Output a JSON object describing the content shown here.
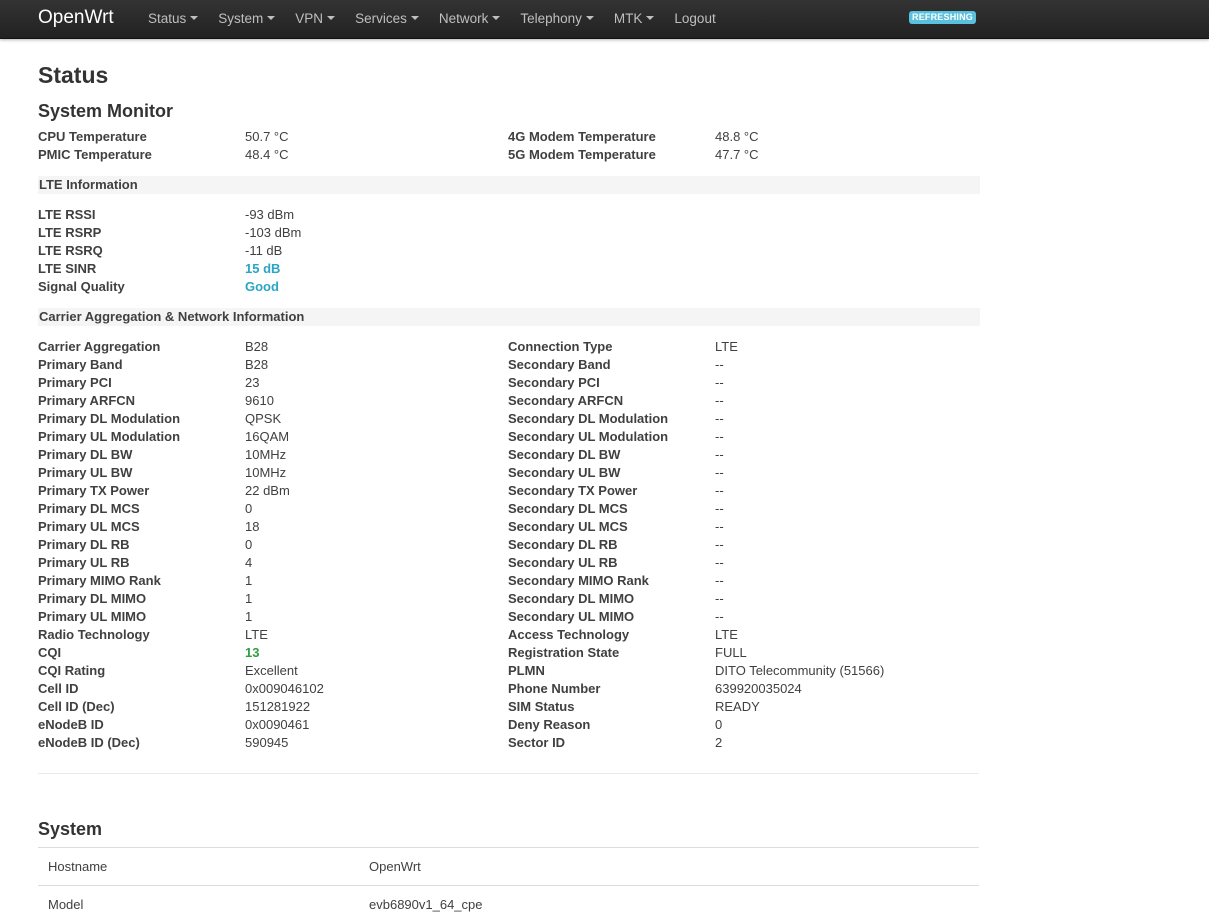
{
  "nav": {
    "brand": "OpenWrt",
    "items": [
      {
        "label": "Status",
        "dropdown": true
      },
      {
        "label": "System",
        "dropdown": true
      },
      {
        "label": "VPN",
        "dropdown": true
      },
      {
        "label": "Services",
        "dropdown": true
      },
      {
        "label": "Network",
        "dropdown": true
      },
      {
        "label": "Telephony",
        "dropdown": true
      },
      {
        "label": "MTK",
        "dropdown": true
      },
      {
        "label": "Logout",
        "dropdown": false
      }
    ],
    "badge": "REFRESHING"
  },
  "page_title": "Status",
  "system_monitor": {
    "title": "System Monitor",
    "rows": [
      {
        "l1": "CPU Temperature",
        "v1": "50.7 °C",
        "l2": "4G Modem Temperature",
        "v2": "48.8 °C"
      },
      {
        "l1": "PMIC Temperature",
        "v1": "48.4 °C",
        "l2": "5G Modem Temperature",
        "v2": "47.7 °C"
      }
    ]
  },
  "lte": {
    "title": "LTE Information",
    "rows": [
      {
        "l1": "LTE RSSI",
        "v1": "-93 dBm"
      },
      {
        "l1": "LTE RSRP",
        "v1": "-103 dBm"
      },
      {
        "l1": "LTE RSRQ",
        "v1": "-11 dB"
      },
      {
        "l1": "LTE SINR",
        "v1": "15 dB",
        "highlight": "blue"
      },
      {
        "l1": "Signal Quality",
        "v1": "Good",
        "highlight": "blue"
      }
    ]
  },
  "carrier": {
    "title": "Carrier Aggregation & Network Information",
    "rows": [
      {
        "l1": "Carrier Aggregation",
        "v1": "B28",
        "l2": "Connection Type",
        "v2": "LTE"
      },
      {
        "l1": "Primary Band",
        "v1": "B28",
        "l2": "Secondary Band",
        "v2": "--"
      },
      {
        "l1": "Primary PCI",
        "v1": "23",
        "l2": "Secondary PCI",
        "v2": "--"
      },
      {
        "l1": "Primary ARFCN",
        "v1": "9610",
        "l2": "Secondary ARFCN",
        "v2": "--"
      },
      {
        "l1": "Primary DL Modulation",
        "v1": "QPSK",
        "l2": "Secondary DL Modulation",
        "v2": "--"
      },
      {
        "l1": "Primary UL Modulation",
        "v1": "16QAM",
        "l2": "Secondary UL Modulation",
        "v2": "--"
      },
      {
        "l1": "Primary DL BW",
        "v1": "10MHz",
        "l2": "Secondary DL BW",
        "v2": "--"
      },
      {
        "l1": "Primary UL BW",
        "v1": "10MHz",
        "l2": "Secondary UL BW",
        "v2": "--"
      },
      {
        "l1": "Primary TX Power",
        "v1": "22 dBm",
        "l2": "Secondary TX Power",
        "v2": "--"
      },
      {
        "l1": "Primary DL MCS",
        "v1": "0",
        "l2": "Secondary DL MCS",
        "v2": "--"
      },
      {
        "l1": "Primary UL MCS",
        "v1": "18",
        "l2": "Secondary UL MCS",
        "v2": "--"
      },
      {
        "l1": "Primary DL RB",
        "v1": "0",
        "l2": "Secondary DL RB",
        "v2": "--"
      },
      {
        "l1": "Primary UL RB",
        "v1": "4",
        "l2": "Secondary UL RB",
        "v2": "--"
      },
      {
        "l1": "Primary MIMO Rank",
        "v1": "1",
        "l2": "Secondary MIMO Rank",
        "v2": "--"
      },
      {
        "l1": "Primary DL MIMO",
        "v1": "1",
        "l2": "Secondary DL MIMO",
        "v2": "--"
      },
      {
        "l1": "Primary UL MIMO",
        "v1": "1",
        "l2": "Secondary UL MIMO",
        "v2": "--"
      },
      {
        "l1": "Radio Technology",
        "v1": "LTE",
        "l2": "Access Technology",
        "v2": "LTE"
      },
      {
        "l1": "CQI",
        "v1": "13",
        "highlight": "green",
        "l2": "Registration State",
        "v2": "FULL"
      },
      {
        "l1": "CQI Rating",
        "v1": "Excellent",
        "l2": "PLMN",
        "v2": "DITO Telecommunity (51566)"
      },
      {
        "l1": "Cell ID",
        "v1": "0x009046102",
        "l2": "Phone Number",
        "v2": "639920035024"
      },
      {
        "l1": "Cell ID (Dec)",
        "v1": "151281922",
        "l2": "SIM Status",
        "v2": "READY"
      },
      {
        "l1": "eNodeB ID",
        "v1": "0x0090461",
        "l2": "Deny Reason",
        "v2": "0"
      },
      {
        "l1": "eNodeB ID (Dec)",
        "v1": "590945",
        "l2": "Sector ID",
        "v2": "2"
      }
    ]
  },
  "system": {
    "title": "System",
    "rows": [
      {
        "key": "Hostname",
        "value": "OpenWrt"
      },
      {
        "key": "Model",
        "value": "evb6890v1_64_cpe"
      }
    ]
  },
  "colors": {
    "navbar": "#222222",
    "badge": "#5bc0de",
    "highlight_blue": "#2aa5c4",
    "highlight_green": "#2ea043"
  }
}
